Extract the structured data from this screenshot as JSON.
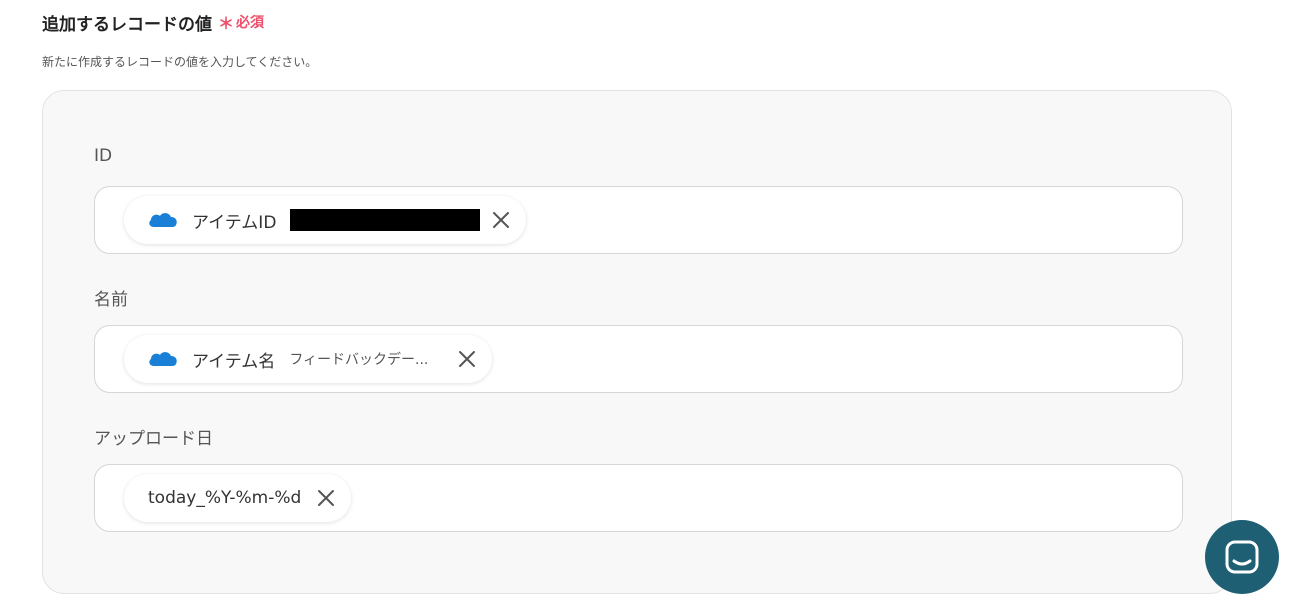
{
  "section": {
    "title": "追加するレコードの値",
    "required_mark": "＊",
    "required_label": "必須",
    "description": "新たに作成するレコードの値を入力してください。"
  },
  "fields": [
    {
      "label": "ID",
      "chip": {
        "icon": "onedrive-cloud-icon",
        "name": "アイテムID",
        "value_redacted": true
      }
    },
    {
      "label": "名前",
      "chip": {
        "icon": "onedrive-cloud-icon",
        "name": "アイテム名",
        "value": "フィードバックデー..."
      }
    },
    {
      "label": "アップロード日",
      "chip": {
        "text": "today_%Y-%m-%d"
      }
    }
  ],
  "colors": {
    "required": "#ee4f6a",
    "cloud": "#1a7fd6",
    "chat_button": "#1e5f74"
  }
}
